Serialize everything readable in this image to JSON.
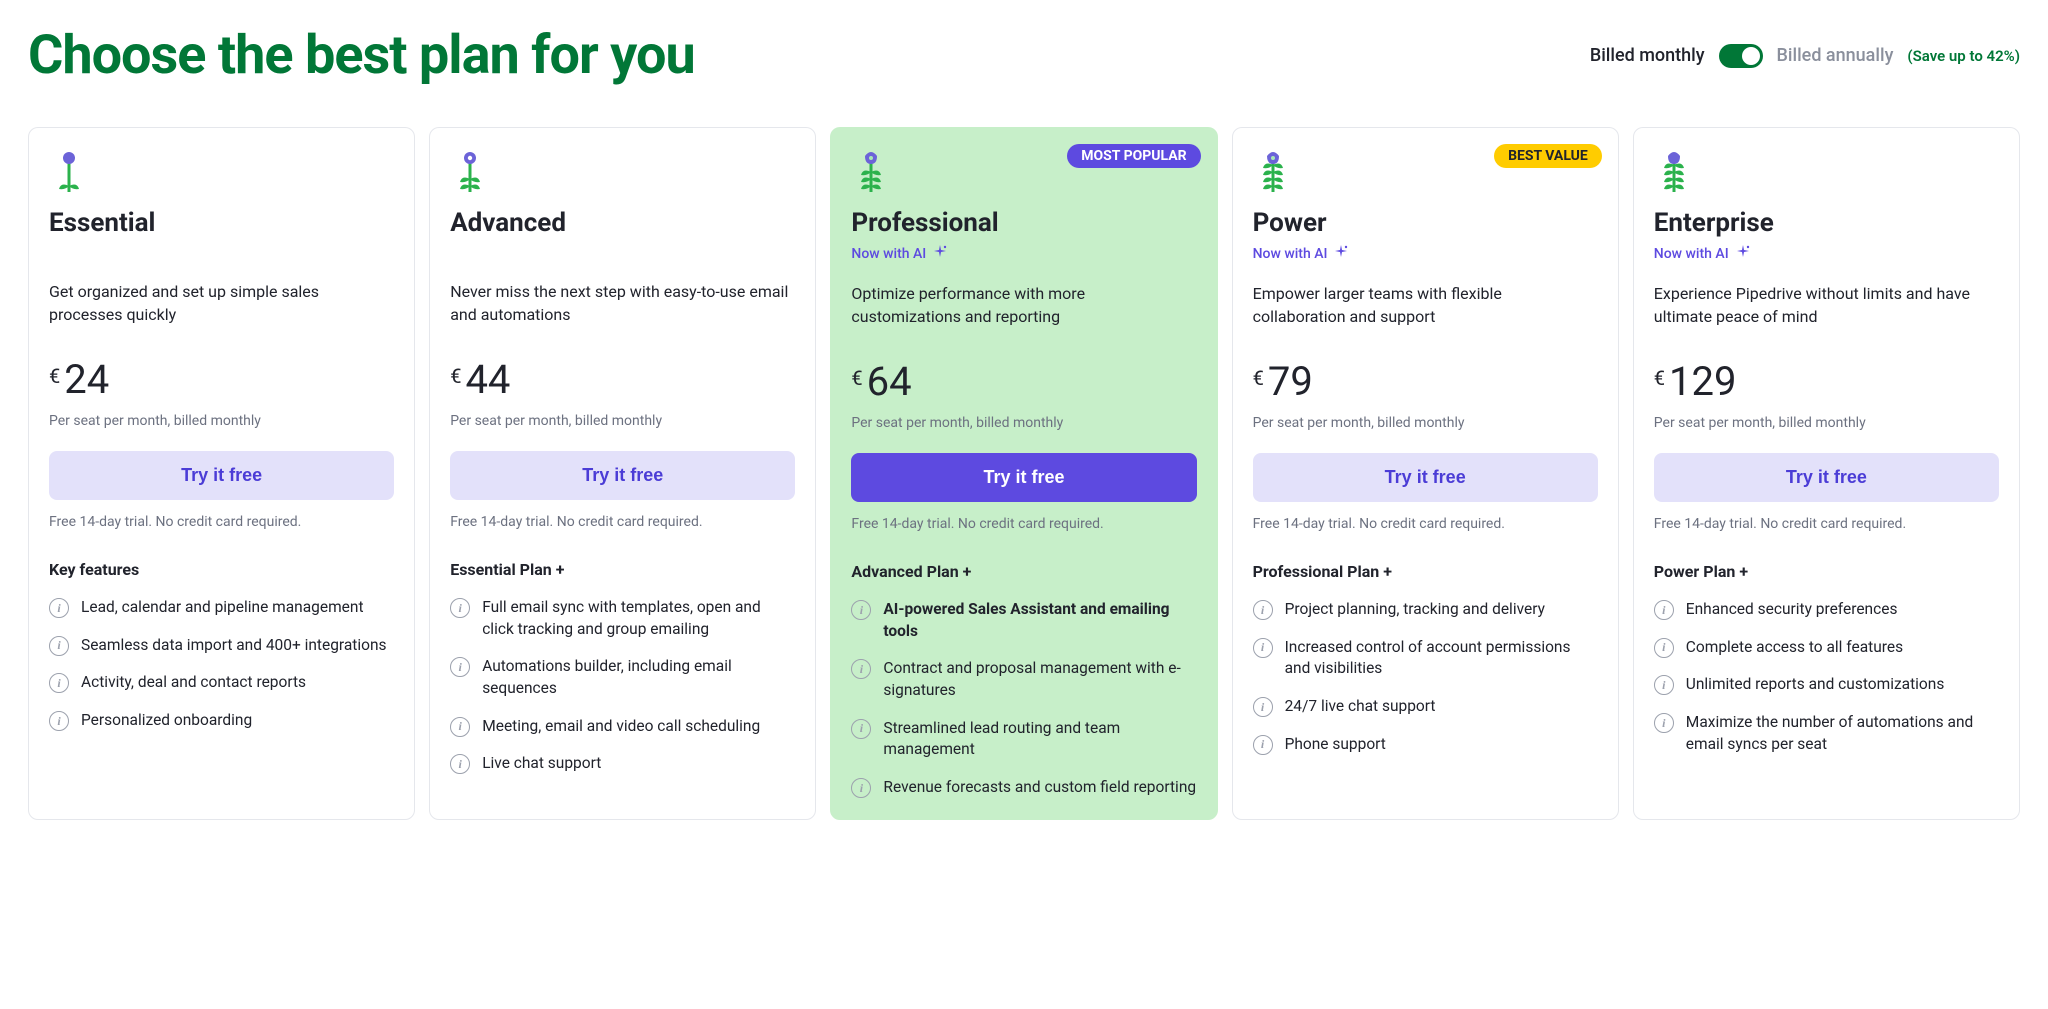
{
  "header": {
    "title": "Choose the best plan for you",
    "billed_monthly": "Billed monthly",
    "billed_annually": "Billed annually",
    "save_note": "(Save up to 42%)"
  },
  "common": {
    "cta_label": "Try it free",
    "trial_note": "Free 14-day trial. No credit card required.",
    "price_sub": "Per seat per month, billed monthly",
    "currency": "€",
    "ai_note": "Now with AI"
  },
  "plans": [
    {
      "id": "essential",
      "name": "Essential",
      "desc": "Get organized and set up simple sales processes quickly",
      "price": "24",
      "ai": false,
      "badge": null,
      "highlight": false,
      "flower_leaves": 1,
      "features_heading": "Key features",
      "features": [
        {
          "text": "Lead, calendar and pipeline management",
          "bold": false
        },
        {
          "text": "Seamless data import and 400+ integrations",
          "bold": false
        },
        {
          "text": "Activity, deal and contact reports",
          "bold": false
        },
        {
          "text": "Personalized onboarding",
          "bold": false
        }
      ]
    },
    {
      "id": "advanced",
      "name": "Advanced",
      "desc": "Never miss the next step with easy-to-use email and automations",
      "price": "44",
      "ai": false,
      "badge": null,
      "highlight": false,
      "flower_leaves": 2,
      "features_heading": "Essential Plan +",
      "features": [
        {
          "text": "Full email sync with templates, open and click tracking and group emailing",
          "bold": false
        },
        {
          "text": "Automations builder, including email sequences",
          "bold": false
        },
        {
          "text": "Meeting, email and video call scheduling",
          "bold": false
        },
        {
          "text": "Live chat support",
          "bold": false
        }
      ]
    },
    {
      "id": "professional",
      "name": "Professional",
      "desc": "Optimize performance with more customizations and reporting",
      "price": "64",
      "ai": true,
      "badge": {
        "type": "popular",
        "label": "MOST POPULAR"
      },
      "highlight": true,
      "flower_leaves": 3,
      "features_heading": "Advanced Plan +",
      "features": [
        {
          "text": "AI-powered Sales Assistant and emailing tools",
          "bold": true
        },
        {
          "text": "Contract and proposal management with e-signatures",
          "bold": false
        },
        {
          "text": "Streamlined lead routing and team management",
          "bold": false
        },
        {
          "text": "Revenue forecasts and custom field reporting",
          "bold": false
        }
      ]
    },
    {
      "id": "power",
      "name": "Power",
      "desc": "Empower larger teams with flexible collaboration and support",
      "price": "79",
      "ai": true,
      "badge": {
        "type": "value",
        "label": "BEST VALUE"
      },
      "highlight": false,
      "flower_leaves": 4,
      "features_heading": "Professional Plan +",
      "features": [
        {
          "text": "Project planning, tracking and delivery",
          "bold": false
        },
        {
          "text": "Increased control of account permissions and visibilities",
          "bold": false
        },
        {
          "text": "24/7 live chat support",
          "bold": false
        },
        {
          "text": "Phone support",
          "bold": false
        }
      ]
    },
    {
      "id": "enterprise",
      "name": "Enterprise",
      "desc": "Experience Pipedrive without limits and have ultimate peace of mind",
      "price": "129",
      "ai": true,
      "badge": null,
      "highlight": false,
      "flower_leaves": 5,
      "features_heading": "Power Plan +",
      "features": [
        {
          "text": "Enhanced security preferences",
          "bold": false
        },
        {
          "text": "Complete access to all features",
          "bold": false
        },
        {
          "text": "Unlimited reports and customizations",
          "bold": false
        },
        {
          "text": "Maximize the number of automations and email syncs per seat",
          "bold": false
        }
      ]
    }
  ]
}
